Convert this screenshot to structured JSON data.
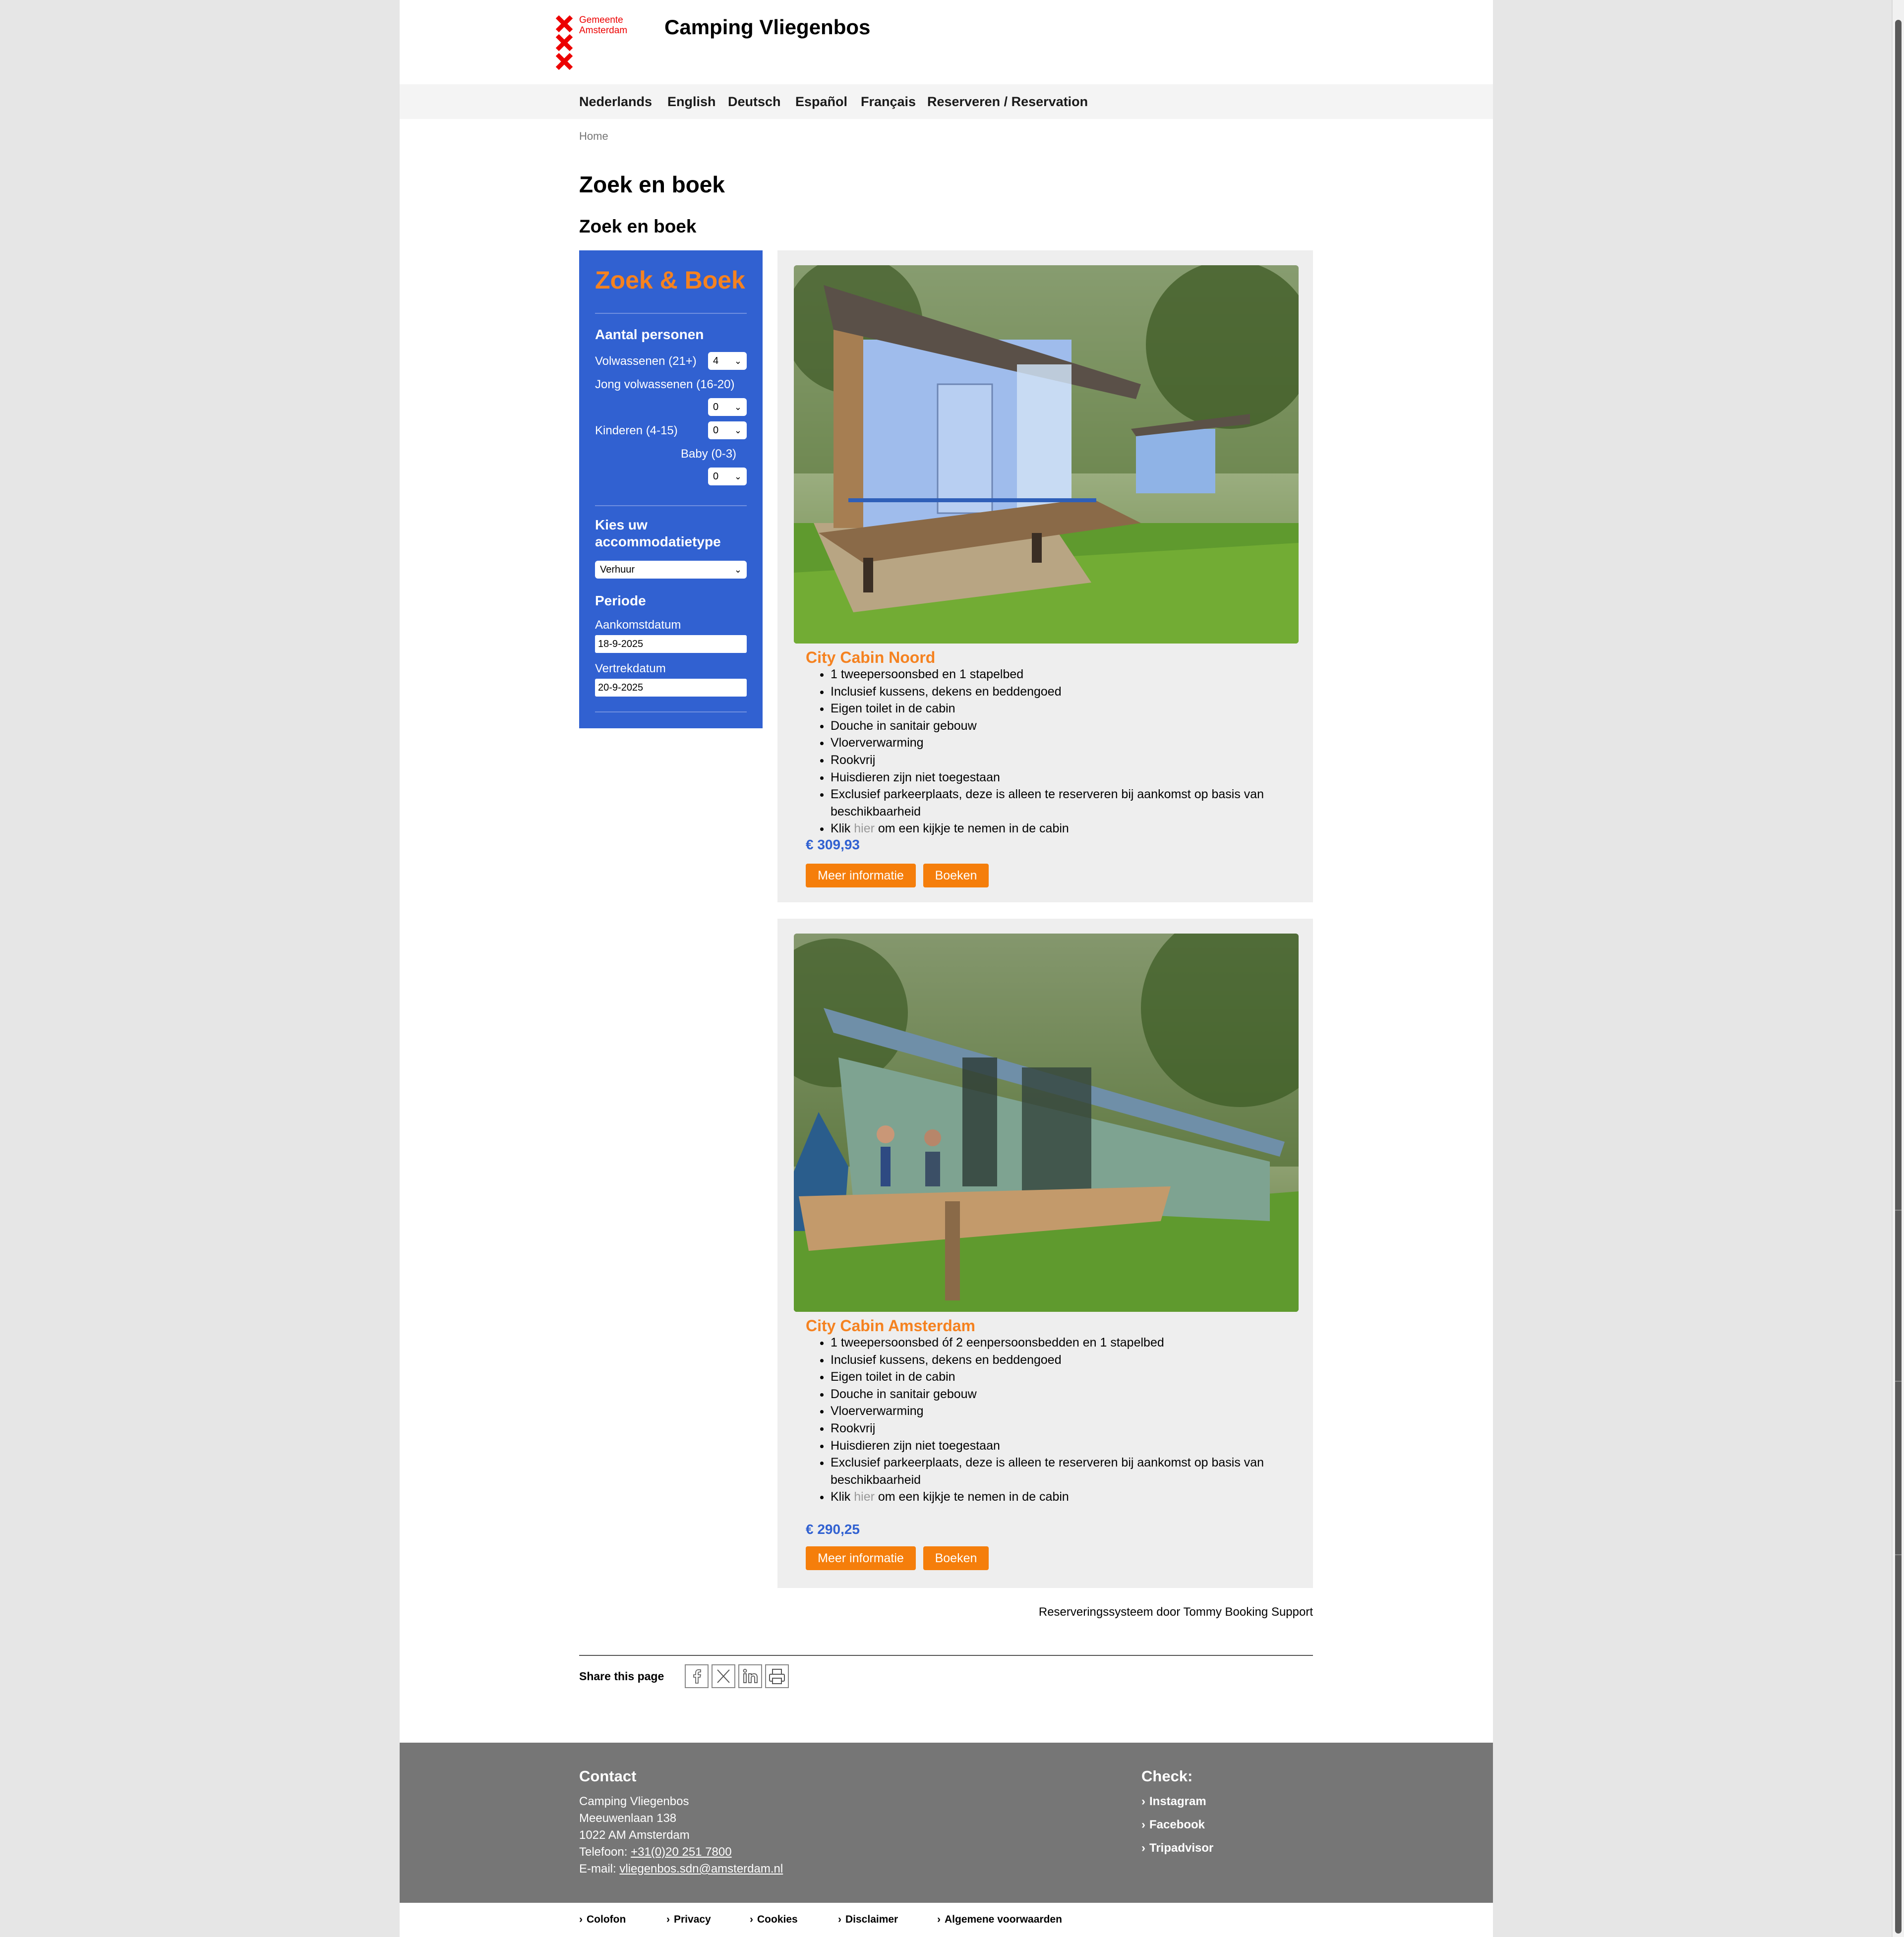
{
  "header": {
    "logo_text": [
      "Gemeente",
      "Amsterdam"
    ],
    "site_title": "Camping Vliegenbos"
  },
  "nav": {
    "items": [
      "Nederlands",
      "English",
      "Deutsch",
      "Español",
      "Français",
      "Reserveren / Reservation"
    ]
  },
  "breadcrumb": "Home",
  "page_title": "Zoek en boek",
  "section_title": "Zoek en boek",
  "search": {
    "title": "Zoek & Boek",
    "persons_heading": "Aantal personen",
    "adults_label": "Volwassenen (21+)",
    "adults_value": "4",
    "young_adults_label": "Jong volwassenen (16-20)",
    "young_adults_value": "0",
    "children_label": "Kinderen (4-15)",
    "children_value": "0",
    "baby_label": "Baby (0-3)",
    "baby_value": "0",
    "accommodation_heading": "Kies uw accommodatietype",
    "accommodation_value": "Verhuur",
    "period_heading": "Periode",
    "arrival_label": "Aankomstdatum",
    "arrival_value": "18-9-2025",
    "departure_label": "Vertrekdatum",
    "departure_value": "20-9-2025"
  },
  "cards": [
    {
      "title": "City Cabin Noord",
      "features": [
        "1 tweepersoonsbed en 1 stapelbed",
        "Inclusief kussens, dekens en beddengoed",
        "Eigen toilet in de cabin",
        "Douche in sanitair gebouw",
        "Vloerverwarming",
        "Rookvrij",
        "Huisdieren zijn niet toegestaan",
        "Exclusief parkeerplaats, deze is alleen te reserveren bij aankomst op basis van beschikbaarheid"
      ],
      "klik_prefix": "Klik ",
      "klik_link": "hier",
      "klik_suffix": " om een kijkje te nemen in de cabin",
      "price": "€ 309,93",
      "more_info": "Meer informatie",
      "book": "Boeken"
    },
    {
      "title": "City Cabin Amsterdam",
      "features": [
        "1 tweepersoonsbed óf 2 eenpersoonsbedden en 1 stapelbed",
        "Inclusief kussens, dekens en beddengoed",
        "Eigen toilet in de cabin",
        "Douche in sanitair gebouw",
        "Vloerverwarming",
        "Rookvrij",
        "Huisdieren zijn niet toegestaan",
        "Exclusief parkeerplaats, deze is alleen te reserveren bij aankomst op basis van beschikbaarheid"
      ],
      "klik_prefix": "Klik ",
      "klik_link": "hier",
      "klik_suffix": " om een kijkje te nemen in de cabin",
      "price": "€ 290,25",
      "more_info": "Meer informatie",
      "book": "Boeken"
    }
  ],
  "powered_by": "Reserveringssysteem door Tommy Booking Support",
  "share": {
    "label": "Share this page",
    "icons": [
      "facebook-icon",
      "x-icon",
      "linkedin-icon",
      "print-icon"
    ]
  },
  "footer": {
    "contact_heading": "Contact",
    "contact_lines": [
      "Camping Vliegenbos",
      "Meeuwenlaan 138",
      "1022 AM Amsterdam"
    ],
    "phone_prefix": "Telefoon: ",
    "phone": "+31(0)20 251 7800",
    "email_prefix": "E-mail: ",
    "email": "vliegenbos.sdn@amsterdam.nl",
    "check_heading": "Check:",
    "check_links": [
      "Instagram",
      "Facebook",
      "Tripadvisor"
    ]
  },
  "sub_footer": [
    "Colofon",
    "Privacy",
    "Cookies",
    "Disclaimer",
    "Algemene voorwaarden"
  ],
  "colors": {
    "brand_blue": "#3161d1",
    "accent_orange": "#f58220",
    "button_orange": "#f57e0b",
    "footer_grey": "#767676",
    "amsterdam_red": "#ec0000"
  }
}
